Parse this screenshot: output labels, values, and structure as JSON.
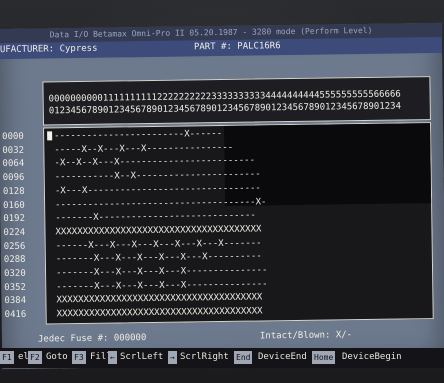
{
  "app": {
    "title_line": "Data I/O Betamax Omni-Pro II 05.20.1987 - 3280 mode (Perform Level)",
    "manufacturer_label": "UFACTURER: Cypress",
    "part_label": "PART #: PALC16R6"
  },
  "grid": {
    "column_header_tens": "00000000001111111111222222222233333333334444444444555555555566666",
    "column_header_ones": "01234567890123456789012345678901234567890123456789012345678901234",
    "rows": [
      {
        "addr": "0000",
        "fuses": "------------------------X------"
      },
      {
        "addr": "0032",
        "fuses": "-----X--X---X---X----------------"
      },
      {
        "addr": "0064",
        "fuses": "-X--X--X---X-------------------------"
      },
      {
        "addr": "0096",
        "fuses": "-----------X--X-----------------------"
      },
      {
        "addr": "0128",
        "fuses": "-X---X--------------------------------"
      },
      {
        "addr": "0160",
        "fuses": "-------------------------------------X-"
      },
      {
        "addr": "0192",
        "fuses": "-------X-----------------------------"
      },
      {
        "addr": "0224",
        "fuses": "XXXXXXXXXXXXXXXXXXXXXXXXXXXXXXXXXXXXXX"
      },
      {
        "addr": "0256",
        "fuses": "------X---X---X---X---X---X---X-------"
      },
      {
        "addr": "0288",
        "fuses": "-------X---X---X---X---X---X----------"
      },
      {
        "addr": "0320",
        "fuses": "-------X---X---X---X---X---------------"
      },
      {
        "addr": "0352",
        "fuses": "-------X---X---X---X---X---------------"
      },
      {
        "addr": "0384",
        "fuses": "XXXXXXXXXXXXXXXXXXXXXXXXXXXXXXXXXXXXXX"
      },
      {
        "addr": "0416",
        "fuses": "XXXXXXXXXXXXXXXXXXXXXXXXXXXXXXXXXXXXXX"
      }
    ]
  },
  "status": {
    "jedec_label": "Jedec Fuse #: 000000",
    "intact_label": "Intact/Blown: X/-"
  },
  "fkeys": [
    {
      "key": "F1",
      "label": "elp"
    },
    {
      "key": "F2",
      "label": "Goto"
    },
    {
      "key": "F3",
      "label": "Fill"
    },
    {
      "key": "←",
      "label": "ScrlLeft"
    },
    {
      "key": "→",
      "label": "ScrlRight"
    },
    {
      "key": "End",
      "label": "DeviceEnd"
    },
    {
      "key": "Home",
      "label": "DeviceBegin"
    }
  ],
  "colors": {
    "screen_bg": "#6d7a8e",
    "header_bg": "#3c4b7a",
    "grid_bg": "#18181b",
    "text": "#ecebe3"
  }
}
